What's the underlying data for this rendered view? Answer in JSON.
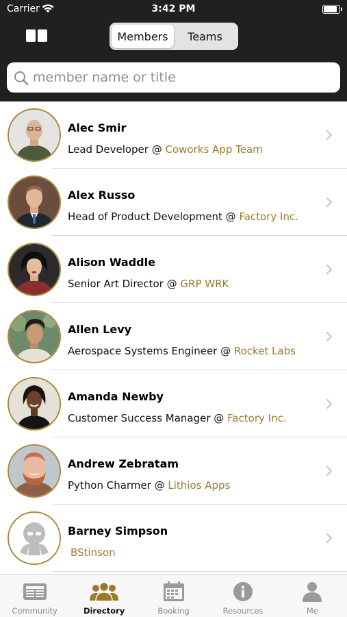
{
  "status_bar": {
    "carrier": "Carrier",
    "time": "3:42 PM"
  },
  "nav": {
    "segments": [
      {
        "label": "Members",
        "selected": true
      },
      {
        "label": "Teams",
        "selected": false
      }
    ]
  },
  "search": {
    "placeholder": "member name or title",
    "value": ""
  },
  "members": [
    {
      "name": "Alec Smir",
      "title": "Lead Developer @ ",
      "company": "Coworks App Team"
    },
    {
      "name": "Alex Russo",
      "title": "Head of Product Development @ ",
      "company": "Factory Inc."
    },
    {
      "name": "Alison Waddle",
      "title": "Senior Art Director @ ",
      "company": "GRP WRK"
    },
    {
      "name": "Allen Levy",
      "title": "Aerospace Systems Engineer @ ",
      "company": "Rocket Labs"
    },
    {
      "name": "Amanda Newby",
      "title": "Customer Success Manager @ ",
      "company": "Factory Inc."
    },
    {
      "name": "Andrew Zebratam",
      "title": "Python Charmer @ ",
      "company": "Lithios Apps"
    },
    {
      "name": "Barney Simpson",
      "title": "",
      "company": "BStinson"
    }
  ],
  "tabs": [
    {
      "label": "Community",
      "icon": "newspaper-icon",
      "active": false
    },
    {
      "label": "Directory",
      "icon": "people-icon",
      "active": true
    },
    {
      "label": "Booking",
      "icon": "calendar-icon",
      "active": false
    },
    {
      "label": "Resources",
      "icon": "info-icon",
      "active": false
    },
    {
      "label": "Me",
      "icon": "person-icon",
      "active": false
    }
  ],
  "colors": {
    "bar_background": "#202020",
    "accent_gold": "#9c7a2d",
    "avatar_ring": "#a8883c",
    "tab_active": "#9c7a2d",
    "tab_inactive": "#9a9a9a"
  }
}
